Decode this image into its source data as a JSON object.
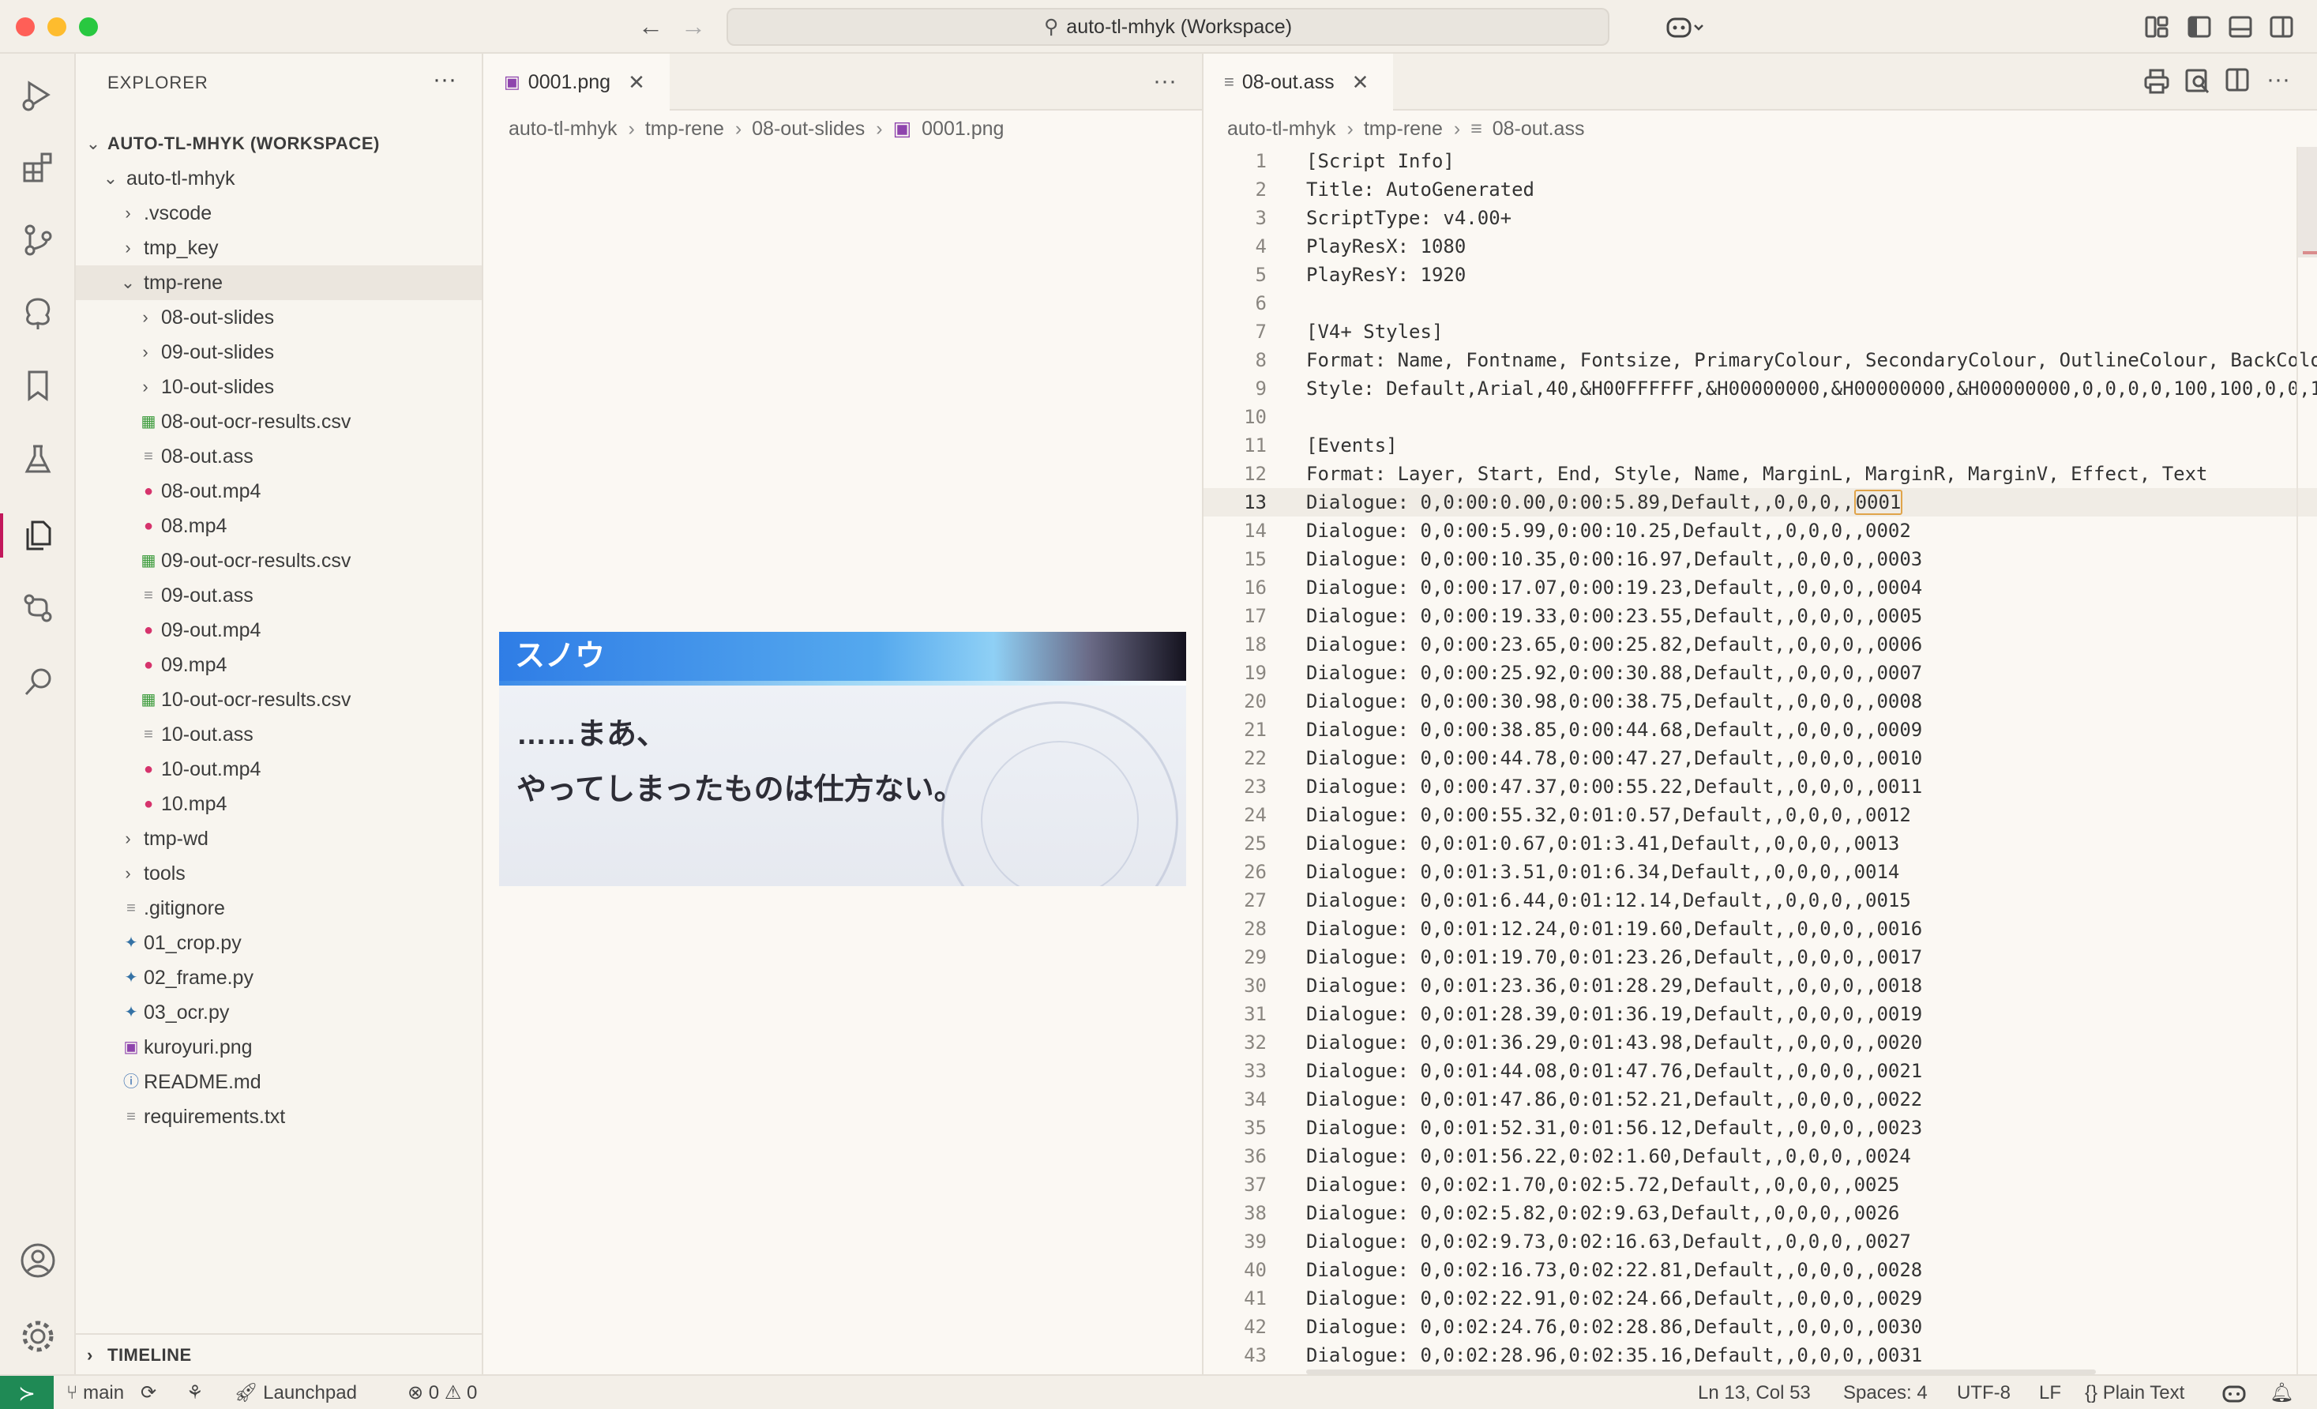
{
  "window": {
    "command_center": "auto-tl-mhyk (Workspace)"
  },
  "sidebar": {
    "title": "EXPLORER",
    "workspace": "AUTO-TL-MHYK (WORKSPACE)",
    "tree": [
      {
        "label": "auto-tl-mhyk",
        "depth": 1,
        "kind": "folder-open",
        "icon": "chevron-down-icon"
      },
      {
        "label": ".vscode",
        "depth": 2,
        "kind": "folder",
        "icon": "chevron-right-icon"
      },
      {
        "label": "tmp_key",
        "depth": 2,
        "kind": "folder",
        "icon": "chevron-right-icon"
      },
      {
        "label": "tmp-rene",
        "depth": 2,
        "kind": "folder-open",
        "icon": "chevron-down-icon",
        "selected": true
      },
      {
        "label": "08-out-slides",
        "depth": 3,
        "kind": "folder",
        "icon": "chevron-right-icon"
      },
      {
        "label": "09-out-slides",
        "depth": 3,
        "kind": "folder",
        "icon": "chevron-right-icon"
      },
      {
        "label": "10-out-slides",
        "depth": 3,
        "kind": "folder",
        "icon": "chevron-right-icon"
      },
      {
        "label": "08-out-ocr-results.csv",
        "depth": 3,
        "kind": "file",
        "icon": "csv-file-icon"
      },
      {
        "label": "08-out.ass",
        "depth": 3,
        "kind": "file",
        "icon": "text-file-icon"
      },
      {
        "label": "08-out.mp4",
        "depth": 3,
        "kind": "file",
        "icon": "video-file-icon"
      },
      {
        "label": "08.mp4",
        "depth": 3,
        "kind": "file",
        "icon": "video-file-icon"
      },
      {
        "label": "09-out-ocr-results.csv",
        "depth": 3,
        "kind": "file",
        "icon": "csv-file-icon"
      },
      {
        "label": "09-out.ass",
        "depth": 3,
        "kind": "file",
        "icon": "text-file-icon"
      },
      {
        "label": "09-out.mp4",
        "depth": 3,
        "kind": "file",
        "icon": "video-file-icon"
      },
      {
        "label": "09.mp4",
        "depth": 3,
        "kind": "file",
        "icon": "video-file-icon"
      },
      {
        "label": "10-out-ocr-results.csv",
        "depth": 3,
        "kind": "file",
        "icon": "csv-file-icon"
      },
      {
        "label": "10-out.ass",
        "depth": 3,
        "kind": "file",
        "icon": "text-file-icon"
      },
      {
        "label": "10-out.mp4",
        "depth": 3,
        "kind": "file",
        "icon": "video-file-icon"
      },
      {
        "label": "10.mp4",
        "depth": 3,
        "kind": "file",
        "icon": "video-file-icon"
      },
      {
        "label": "tmp-wd",
        "depth": 2,
        "kind": "folder",
        "icon": "chevron-right-icon"
      },
      {
        "label": "tools",
        "depth": 2,
        "kind": "folder",
        "icon": "chevron-right-icon"
      },
      {
        "label": ".gitignore",
        "depth": 2,
        "kind": "file",
        "icon": "text-file-icon"
      },
      {
        "label": "01_crop.py",
        "depth": 2,
        "kind": "file",
        "icon": "python-file-icon"
      },
      {
        "label": "02_frame.py",
        "depth": 2,
        "kind": "file",
        "icon": "python-file-icon"
      },
      {
        "label": "03_ocr.py",
        "depth": 2,
        "kind": "file",
        "icon": "python-file-icon"
      },
      {
        "label": "kuroyuri.png",
        "depth": 2,
        "kind": "file",
        "icon": "image-file-icon"
      },
      {
        "label": "README.md",
        "depth": 2,
        "kind": "file",
        "icon": "info-file-icon"
      },
      {
        "label": "requirements.txt",
        "depth": 2,
        "kind": "file",
        "icon": "text-file-icon"
      }
    ],
    "timeline": "TIMELINE"
  },
  "image_editor": {
    "tab": "0001.png",
    "breadcrumb": [
      "auto-tl-mhyk",
      "tmp-rene",
      "08-out-slides",
      "0001.png"
    ],
    "preview": {
      "speaker": "スノウ",
      "line1": "……まあ、",
      "line2": "やってしまったものは仕方ない。"
    }
  },
  "text_editor": {
    "tab": "08-out.ass",
    "breadcrumb": [
      "auto-tl-mhyk",
      "tmp-rene",
      "08-out.ass"
    ],
    "current_line": 13,
    "lines": [
      "[Script Info]",
      "Title: AutoGenerated",
      "ScriptType: v4.00+",
      "PlayResX: 1080",
      "PlayResY: 1920",
      "",
      "[V4+ Styles]",
      "Format: Name, Fontname, Fontsize, PrimaryColour, SecondaryColour, OutlineColour, BackColo",
      "Style: Default,Arial,40,&H00FFFFFF,&H00000000,&H00000000,&H00000000,0,0,0,0,100,100,0,0,1",
      "",
      "[Events]",
      "Format: Layer, Start, End, Style, Name, MarginL, MarginR, MarginV, Effect, Text",
      "Dialogue: 0,0:00:0.00,0:00:5.89,Default,,0,0,0,,0001",
      "Dialogue: 0,0:00:5.99,0:00:10.25,Default,,0,0,0,,0002",
      "Dialogue: 0,0:00:10.35,0:00:16.97,Default,,0,0,0,,0003",
      "Dialogue: 0,0:00:17.07,0:00:19.23,Default,,0,0,0,,0004",
      "Dialogue: 0,0:00:19.33,0:00:23.55,Default,,0,0,0,,0005",
      "Dialogue: 0,0:00:23.65,0:00:25.82,Default,,0,0,0,,0006",
      "Dialogue: 0,0:00:25.92,0:00:30.88,Default,,0,0,0,,0007",
      "Dialogue: 0,0:00:30.98,0:00:38.75,Default,,0,0,0,,0008",
      "Dialogue: 0,0:00:38.85,0:00:44.68,Default,,0,0,0,,0009",
      "Dialogue: 0,0:00:44.78,0:00:47.27,Default,,0,0,0,,0010",
      "Dialogue: 0,0:00:47.37,0:00:55.22,Default,,0,0,0,,0011",
      "Dialogue: 0,0:00:55.32,0:01:0.57,Default,,0,0,0,,0012",
      "Dialogue: 0,0:01:0.67,0:01:3.41,Default,,0,0,0,,0013",
      "Dialogue: 0,0:01:3.51,0:01:6.34,Default,,0,0,0,,0014",
      "Dialogue: 0,0:01:6.44,0:01:12.14,Default,,0,0,0,,0015",
      "Dialogue: 0,0:01:12.24,0:01:19.60,Default,,0,0,0,,0016",
      "Dialogue: 0,0:01:19.70,0:01:23.26,Default,,0,0,0,,0017",
      "Dialogue: 0,0:01:23.36,0:01:28.29,Default,,0,0,0,,0018",
      "Dialogue: 0,0:01:28.39,0:01:36.19,Default,,0,0,0,,0019",
      "Dialogue: 0,0:01:36.29,0:01:43.98,Default,,0,0,0,,0020",
      "Dialogue: 0,0:01:44.08,0:01:47.76,Default,,0,0,0,,0021",
      "Dialogue: 0,0:01:47.86,0:01:52.21,Default,,0,0,0,,0022",
      "Dialogue: 0,0:01:52.31,0:01:56.12,Default,,0,0,0,,0023",
      "Dialogue: 0,0:01:56.22,0:02:1.60,Default,,0,0,0,,0024",
      "Dialogue: 0,0:02:1.70,0:02:5.72,Default,,0,0,0,,0025",
      "Dialogue: 0,0:02:5.82,0:02:9.63,Default,,0,0,0,,0026",
      "Dialogue: 0,0:02:9.73,0:02:16.63,Default,,0,0,0,,0027",
      "Dialogue: 0,0:02:16.73,0:02:22.81,Default,,0,0,0,,0028",
      "Dialogue: 0,0:02:22.91,0:02:24.66,Default,,0,0,0,,0029",
      "Dialogue: 0,0:02:24.76,0:02:28.86,Default,,0,0,0,,0030",
      "Dialogue: 0,0:02:28.96,0:02:35.16,Default,,0,0,0,,0031"
    ]
  },
  "statusbar": {
    "branch": "main",
    "launchpad": "Launchpad",
    "errors": "0",
    "warnings": "0",
    "cursor": "Ln 13, Col 53",
    "spaces": "Spaces: 4",
    "encoding": "UTF-8",
    "eol": "LF",
    "language": "Plain Text"
  },
  "colors": {
    "accent": "#c2185b",
    "remote_badge": "#1f8a55",
    "csv_icon": "#3a9a3a",
    "video_icon": "#d6336c",
    "python_icon": "#3572a5",
    "image_icon": "#8e44ad"
  }
}
